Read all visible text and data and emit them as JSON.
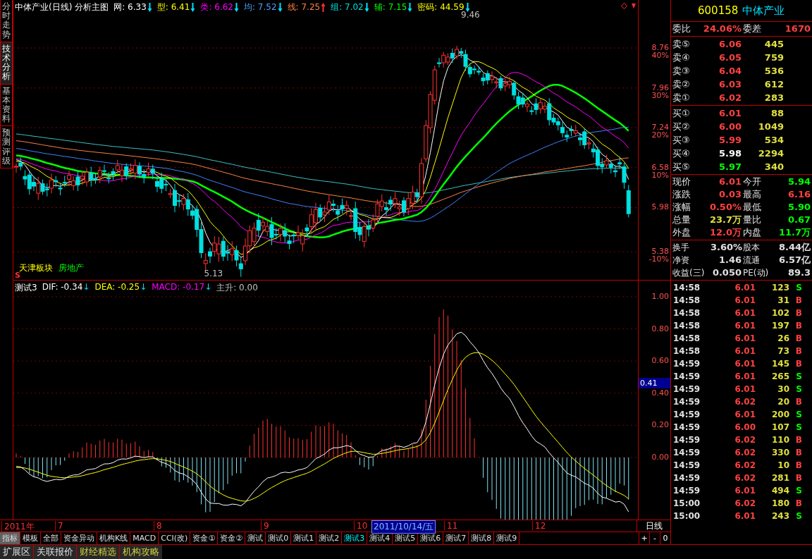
{
  "side_tabs": [
    {
      "label": "分时走势",
      "selected": false
    },
    {
      "label": "技术分析",
      "selected": true
    },
    {
      "label": "基本资料",
      "selected": false
    },
    {
      "label": "预测评级",
      "selected": false
    }
  ],
  "chart_header": {
    "title": "中体产业(日线) 分析主图",
    "indicators": [
      {
        "label": "网:",
        "value": "6.33",
        "arrow": {
          "rising": false,
          "color": "#00e0ff"
        },
        "color": "#ffffff"
      },
      {
        "label": "型:",
        "value": "6.41",
        "arrow": {
          "rising": false,
          "color": "#00e0ff"
        },
        "color": "#ffff00"
      },
      {
        "label": "类:",
        "value": "6.62",
        "arrow": {
          "rising": false,
          "color": "#00e0ff"
        },
        "color": "#ff00ff"
      },
      {
        "label": "均:",
        "value": "7.52",
        "arrow": {
          "rising": false,
          "color": "#00e0ff"
        },
        "color": "#4aa0ff"
      },
      {
        "label": "线:",
        "value": "7.25",
        "arrow": {
          "rising": true,
          "color": "#ff3030"
        },
        "color": "#ff8040"
      },
      {
        "label": "组:",
        "value": "7.02",
        "arrow": {
          "rising": false,
          "color": "#00e0ff"
        },
        "color": "#00e0e0"
      },
      {
        "label": "辅:",
        "value": "7.15",
        "arrow": {
          "rising": false,
          "color": "#00e0ff"
        },
        "color": "#00ff00"
      },
      {
        "label": "密码:",
        "value": "44.59",
        "arrow": {
          "rising": false,
          "color": "#00e0ff"
        },
        "color": "#ffff00"
      }
    ]
  },
  "price_annotations": {
    "high": "9.46",
    "low": "5.13",
    "sector": "天津板块",
    "industry": "房地产",
    "signal": "S"
  },
  "price_axis": [
    {
      "price": "8.76",
      "percent": "40%"
    },
    {
      "price": "7.96",
      "percent": "30%"
    },
    {
      "price": "7.24",
      "percent": "20%"
    },
    {
      "price": "6.58",
      "percent": "10%"
    },
    {
      "price": "5.98"
    },
    {
      "price": "5.38",
      "percent": "-10%"
    }
  ],
  "indicator_header": {
    "name": "测试3",
    "items": [
      {
        "label": "DIF:",
        "value": "-0.34",
        "arrow": "↓",
        "color": "#ffffff"
      },
      {
        "label": "DEA:",
        "value": "-0.25",
        "arrow": "↓",
        "color": "#ffff00"
      },
      {
        "label": "MACD:",
        "value": "-0.17",
        "arrow": "↓",
        "color": "#ff00ff"
      },
      {
        "label": "主升:",
        "value": "0.00",
        "color": "#c0c0c0"
      }
    ]
  },
  "indicator_axis": {
    "ticks": [
      "1.00",
      "0.80",
      "0.60",
      "0.40",
      "0.20",
      "0.00"
    ],
    "current": "0.41"
  },
  "date_axis": {
    "labels": [
      "2011年",
      "7",
      "8",
      "9",
      "10",
      "11",
      "12"
    ],
    "cursor_date": "2011/10/14/五",
    "period": "日线"
  },
  "mode_buttons": [
    {
      "label": "指标",
      "selected": true
    },
    {
      "label": "模板",
      "selected": false
    }
  ],
  "indicator_tabs": [
    {
      "label": "全部",
      "selected": false
    },
    {
      "label": "资金异动",
      "selected": false
    },
    {
      "label": "机构K线",
      "selected": false
    },
    {
      "label": "MACD",
      "selected": false
    },
    {
      "label": "CCI(改)",
      "selected": false
    },
    {
      "label": "资金①",
      "selected": false
    },
    {
      "label": "资金②",
      "selected": false
    },
    {
      "label": "测试",
      "selected": false
    },
    {
      "label": "测试0",
      "selected": false
    },
    {
      "label": "测试1",
      "selected": false
    },
    {
      "label": "测试2",
      "selected": false
    },
    {
      "label": "测试3",
      "selected": true
    },
    {
      "label": "测试4",
      "selected": false
    },
    {
      "label": "测试5",
      "selected": false
    },
    {
      "label": "测试6",
      "selected": false
    },
    {
      "label": "测试7",
      "selected": false
    },
    {
      "label": "测试8",
      "selected": false
    },
    {
      "label": "测试9",
      "selected": false
    }
  ],
  "zoom_buttons": [
    "+",
    "-",
    "0"
  ],
  "bottom_tabs": [
    {
      "label": "扩展区",
      "highlighted": false
    },
    {
      "label": "关联报价",
      "highlighted": false
    },
    {
      "label": "财经精选",
      "highlighted": true
    },
    {
      "label": "机构攻略",
      "highlighted": true
    }
  ],
  "quote": {
    "code": "600158",
    "name": "中体产业",
    "commission": [
      {
        "label": "委比",
        "value": "24.06%"
      },
      {
        "label": "委差",
        "value": "1670"
      }
    ],
    "asks": [
      {
        "label": "卖⑤",
        "price": "6.06",
        "volume": "445",
        "color": "#ff4040"
      },
      {
        "label": "卖④",
        "price": "6.05",
        "volume": "759",
        "color": "#ff4040"
      },
      {
        "label": "卖③",
        "price": "6.04",
        "volume": "536",
        "color": "#ff4040"
      },
      {
        "label": "卖②",
        "price": "6.03",
        "volume": "612",
        "color": "#ff4040"
      },
      {
        "label": "卖①",
        "price": "6.02",
        "volume": "283",
        "color": "#ff4040"
      }
    ],
    "bids": [
      {
        "label": "买①",
        "price": "6.01",
        "volume": "88",
        "color": "#ff4040"
      },
      {
        "label": "买②",
        "price": "6.00",
        "volume": "1049",
        "color": "#ff4040"
      },
      {
        "label": "买③",
        "price": "5.99",
        "volume": "534",
        "color": "#ff4040"
      },
      {
        "label": "买④",
        "price": "5.98",
        "volume": "2294",
        "color": "#ffffff"
      },
      {
        "label": "买⑤",
        "price": "5.97",
        "volume": "340",
        "color": "#00ff00"
      }
    ],
    "stats": [
      [
        {
          "label": "现价",
          "value": "6.01",
          "color": "#ff4040"
        },
        {
          "label": "今开",
          "value": "5.94",
          "color": "#00ff00"
        }
      ],
      [
        {
          "label": "涨跌",
          "value": "0.03",
          "color": "#ff4040"
        },
        {
          "label": "最高",
          "value": "6.16",
          "color": "#ff4040"
        }
      ],
      [
        {
          "label": "涨幅",
          "value": "0.50%",
          "color": "#ff4040"
        },
        {
          "label": "最低",
          "value": "5.90",
          "color": "#00ff00"
        }
      ],
      [
        {
          "label": "总量",
          "value": "23.7万",
          "color": "#e0e040"
        },
        {
          "label": "量比",
          "value": "0.67",
          "color": "#00ff00"
        }
      ],
      [
        {
          "label": "外盘",
          "value": "12.0万",
          "color": "#ff4040"
        },
        {
          "label": "内盘",
          "value": "11.7万",
          "color": "#00ff00"
        }
      ]
    ],
    "fundamentals": [
      [
        {
          "label": "换手",
          "value": "3.60%"
        },
        {
          "label": "股本",
          "value": "8.44亿"
        }
      ],
      [
        {
          "label": "净资",
          "value": "1.46"
        },
        {
          "label": "流通",
          "value": "6.57亿"
        }
      ],
      [
        {
          "label": "收益(三)",
          "value": "0.050"
        },
        {
          "label": "PE(动)",
          "value": "89.3"
        }
      ]
    ]
  },
  "trades": [
    {
      "time": "14:58",
      "price": "6.01",
      "volume": "123",
      "side": "S",
      "kind": "sell"
    },
    {
      "time": "14:58",
      "price": "6.01",
      "volume": "31",
      "side": "B",
      "kind": "buy"
    },
    {
      "time": "14:58",
      "price": "6.01",
      "volume": "102",
      "side": "B",
      "kind": "buy"
    },
    {
      "time": "14:58",
      "price": "6.01",
      "volume": "197",
      "side": "B",
      "kind": "buy"
    },
    {
      "time": "14:58",
      "price": "6.01",
      "volume": "26",
      "side": "B",
      "kind": "buy"
    },
    {
      "time": "14:58",
      "price": "6.01",
      "volume": "73",
      "side": "B",
      "kind": "buy"
    },
    {
      "time": "14:59",
      "price": "6.01",
      "volume": "145",
      "side": "B",
      "kind": "buy"
    },
    {
      "time": "14:59",
      "price": "6.01",
      "volume": "265",
      "side": "S",
      "kind": "sell"
    },
    {
      "time": "14:59",
      "price": "6.01",
      "volume": "30",
      "side": "S",
      "kind": "sell"
    },
    {
      "time": "14:59",
      "price": "6.02",
      "volume": "20",
      "side": "B",
      "kind": "buy"
    },
    {
      "time": "14:59",
      "price": "6.01",
      "volume": "200",
      "side": "S",
      "kind": "sell"
    },
    {
      "time": "14:59",
      "price": "6.00",
      "volume": "107",
      "side": "S",
      "kind": "sell"
    },
    {
      "time": "14:59",
      "price": "6.02",
      "volume": "110",
      "side": "B",
      "kind": "buy"
    },
    {
      "time": "14:59",
      "price": "6.02",
      "volume": "330",
      "side": "B",
      "kind": "buy"
    },
    {
      "time": "14:59",
      "price": "6.02",
      "volume": "10",
      "side": "B",
      "kind": "buy"
    },
    {
      "time": "14:59",
      "price": "6.02",
      "volume": "281",
      "side": "B",
      "kind": "buy"
    },
    {
      "time": "14:59",
      "price": "6.01",
      "volume": "494",
      "side": "S",
      "kind": "sell"
    },
    {
      "time": "15:00",
      "price": "6.02",
      "volume": "180",
      "side": "B",
      "kind": "buy"
    },
    {
      "time": "15:00",
      "price": "6.01",
      "volume": "243",
      "side": "S",
      "kind": "sell"
    }
  ]
}
